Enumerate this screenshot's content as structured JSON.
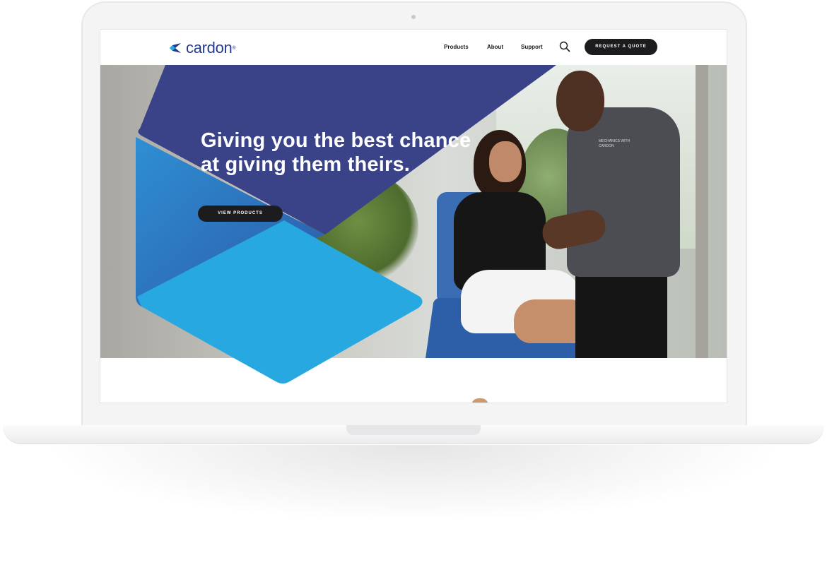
{
  "header": {
    "logo_text": "cardon",
    "logo_reg": "®",
    "nav": {
      "products": "Products",
      "about": "About",
      "support": "Support"
    },
    "search_icon": "search-icon",
    "quote_button": "REQUEST A QUOTE"
  },
  "hero": {
    "headline_line1": "Giving you the best chance",
    "headline_line2": "at giving them theirs.",
    "cta_button": "VIEW PRODUCTS",
    "shirt_text": "MECHANICS WITH CARDON"
  },
  "colors": {
    "brand_dark_blue": "#3a4288",
    "brand_mid_blue": "#2e86c8",
    "brand_light_blue": "#27a8e1",
    "button_dark": "#1c1c1e"
  }
}
